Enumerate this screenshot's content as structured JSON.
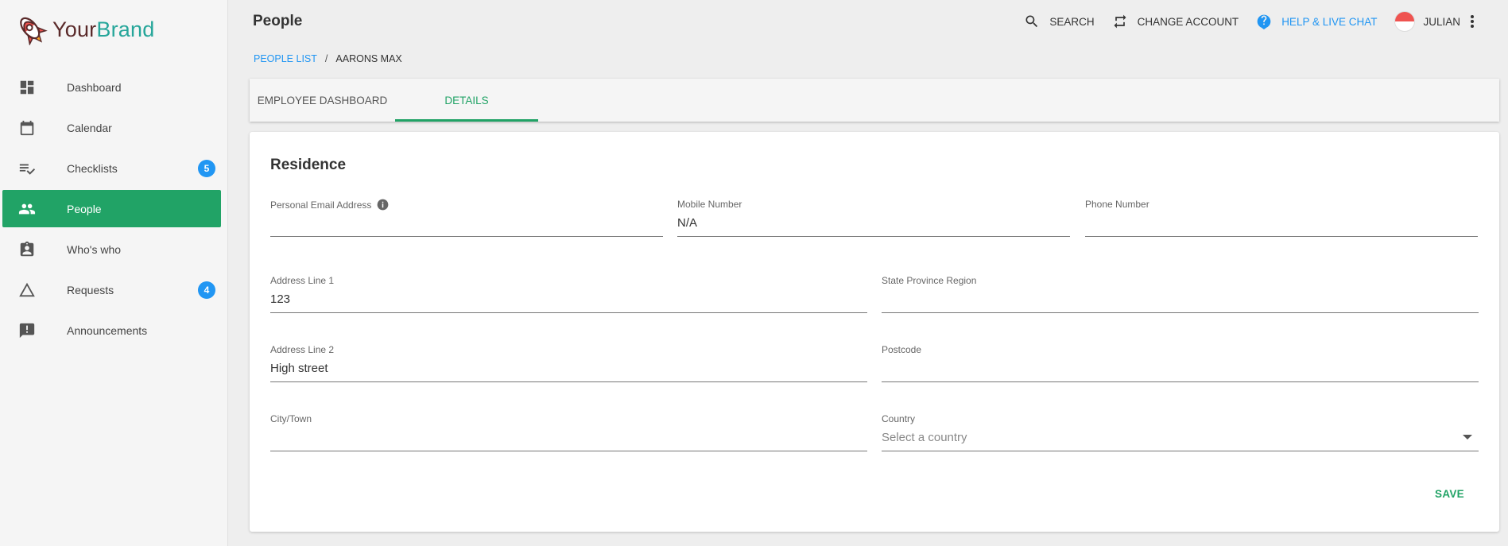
{
  "brand": {
    "part1": "Your",
    "part2": "Brand",
    "logo_icon": "rocket-icon"
  },
  "sidebar": {
    "items": [
      {
        "label": "Dashboard",
        "icon": "dashboard-icon"
      },
      {
        "label": "Calendar",
        "icon": "calendar-icon"
      },
      {
        "label": "Checklists",
        "icon": "checklist-icon",
        "badge": "5"
      },
      {
        "label": "People",
        "icon": "people-icon",
        "active": true
      },
      {
        "label": "Who's who",
        "icon": "contact-badge-icon"
      },
      {
        "label": "Requests",
        "icon": "triangle-icon",
        "badge": "4"
      },
      {
        "label": "Announcements",
        "icon": "announcement-icon"
      }
    ],
    "active_color": "#21a366",
    "badge_color": "#2196f3"
  },
  "header": {
    "title": "People",
    "search_label": "SEARCH",
    "change_account_label": "CHANGE ACCOUNT",
    "help_label": "HELP & LIVE CHAT",
    "user_name": "JULIAN"
  },
  "breadcrumb": {
    "link": "PEOPLE LIST",
    "separator": "/",
    "current": "AARONS MAX"
  },
  "tabs": [
    {
      "label": "EMPLOYEE DASHBOARD",
      "active": false
    },
    {
      "label": "DETAILS",
      "active": true
    }
  ],
  "form": {
    "section_title": "Residence",
    "personal_email": {
      "label": "Personal Email Address",
      "value": ""
    },
    "mobile_number": {
      "label": "Mobile Number",
      "value": "N/A"
    },
    "phone_number": {
      "label": "Phone Number",
      "value": ""
    },
    "address_line_1": {
      "label": "Address Line 1",
      "value": "123"
    },
    "state_province_region": {
      "label": "State Province Region",
      "value": ""
    },
    "address_line_2": {
      "label": "Address Line 2",
      "value": "High street"
    },
    "postcode": {
      "label": "Postcode",
      "value": ""
    },
    "city_town": {
      "label": "City/Town",
      "value": ""
    },
    "country": {
      "label": "Country",
      "value": "",
      "placeholder": "Select a country"
    },
    "save_label": "SAVE"
  },
  "colors": {
    "accent_green": "#21a366",
    "link_blue": "#2196f3",
    "brand_teal": "#26a69a"
  }
}
